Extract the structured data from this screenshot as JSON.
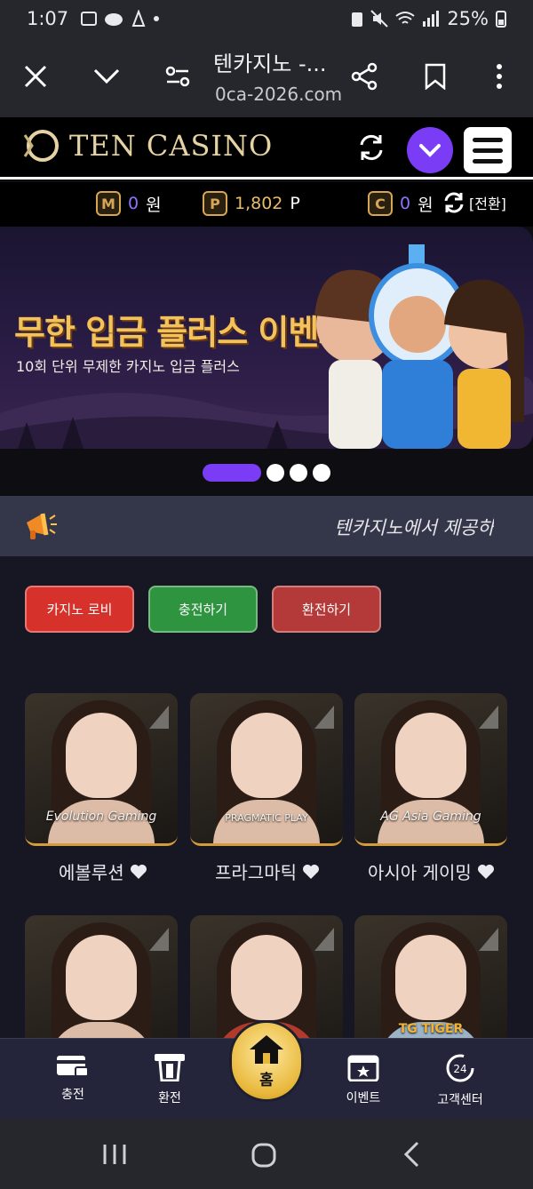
{
  "status_bar": {
    "time": "1:07",
    "battery": "25%"
  },
  "browser": {
    "title": "텐카지노 -...",
    "url": "0ca-2026.com"
  },
  "site": {
    "logo": "TEN CASINO",
    "balance": {
      "m_value": "0",
      "m_unit": "원",
      "p_value": "1,802",
      "p_unit": "P",
      "c_value": "0",
      "c_unit": "원",
      "convert_label": "[전환]"
    }
  },
  "banner": {
    "title": "무한 입금 플러스 이벤트",
    "subtitle": "10회 단위 무제한 카지노 입금 플러스"
  },
  "notice": {
    "text": "텐카지노에서 제공하는"
  },
  "actions": [
    {
      "label": "카지노 로비",
      "color": "#d6322b"
    },
    {
      "label": "충전하기",
      "color": "#2e9440"
    },
    {
      "label": "환전하기",
      "color": "#b33a38"
    }
  ],
  "games": [
    {
      "name": "에볼루션",
      "brand": "Evolution Gaming"
    },
    {
      "name": "프라그마틱",
      "brand": "PRAGMATIC PLAY"
    },
    {
      "name": "아시아 게이밍",
      "brand": "AG Asia Gaming"
    },
    {
      "brand": ""
    },
    {
      "brand": ""
    },
    {
      "brand": "TG TIGER"
    }
  ],
  "bottom_nav": {
    "charge": "충전",
    "exchange": "환전",
    "home": "홈",
    "events": "이벤트",
    "support": "고객센터"
  },
  "colors": {
    "accent": "#7b3cf5",
    "gold": "#e8b83b",
    "bg": "#161722"
  }
}
